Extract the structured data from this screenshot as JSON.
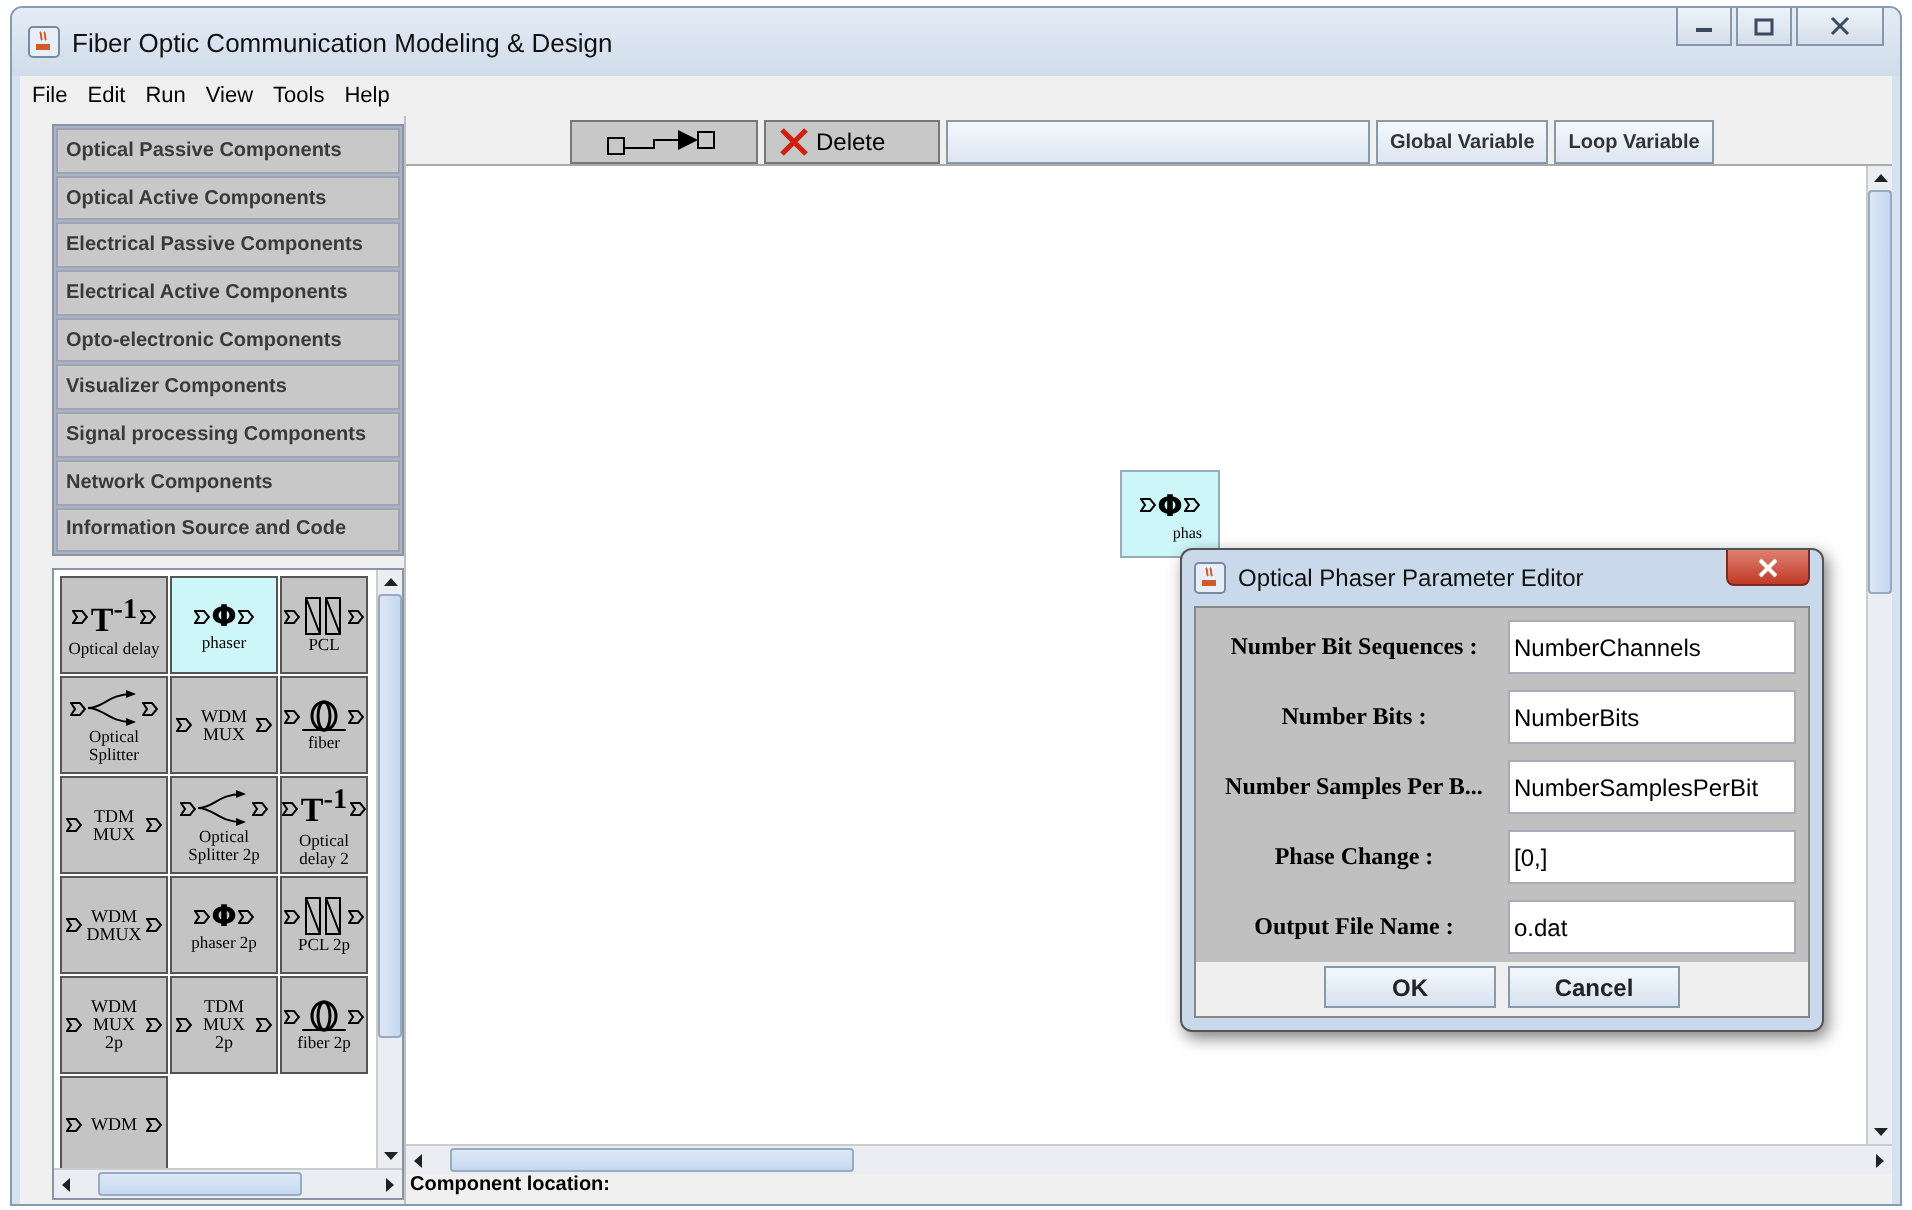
{
  "window": {
    "title": "Fiber Optic Communication Modeling & Design"
  },
  "menu": [
    "File",
    "Edit",
    "Run",
    "View",
    "Tools",
    "Help"
  ],
  "toolbar": {
    "delete": "Delete",
    "buttons": [
      "Global Variable",
      "Loop Variable"
    ]
  },
  "categories": [
    "Optical Passive Components",
    "Optical Active Components",
    "Electrical Passive Components",
    "Electrical Active Components",
    "Opto-electronic Components",
    "Visualizer Components",
    "Signal processing Components",
    "Network Components",
    "Information Source and Code"
  ],
  "palette": [
    {
      "kind": "delay",
      "symbol": "T$^{-1}$",
      "label": "Optical delay",
      "selected": false
    },
    {
      "kind": "phaser",
      "symbol": "Φ",
      "label": "phaser",
      "selected": true
    },
    {
      "kind": "pcl",
      "label": "PCL",
      "selected": false
    },
    {
      "kind": "splitter",
      "label": "Optical Splitter",
      "selected": false
    },
    {
      "kind": "mux",
      "symbol": "WDM MUX",
      "selected": false
    },
    {
      "kind": "fiber",
      "label": "fiber",
      "selected": false
    },
    {
      "kind": "mux",
      "symbol": "TDM MUX",
      "selected": false
    },
    {
      "kind": "splitter",
      "label": "Optical Splitter 2p",
      "selected": false
    },
    {
      "kind": "delay",
      "symbol": "T$^{-1}$",
      "label": "Optical delay 2",
      "selected": false
    },
    {
      "kind": "mux",
      "symbol": "WDM DMUX",
      "selected": false
    },
    {
      "kind": "phaser",
      "symbol": "Φ",
      "label": "phaser 2p",
      "selected": false
    },
    {
      "kind": "pcl",
      "label": "PCL 2p",
      "selected": false
    },
    {
      "kind": "mux",
      "symbol": "WDM MUX 2p",
      "selected": false
    },
    {
      "kind": "mux",
      "symbol": "TDM MUX 2p",
      "selected": false
    },
    {
      "kind": "fiber",
      "label": "fiber 2p",
      "selected": false
    },
    {
      "kind": "mux",
      "symbol": "WDM",
      "selected": false
    }
  ],
  "canvas": {
    "node": {
      "symbol": "Φ",
      "label": "phas",
      "selected": true
    }
  },
  "dialog": {
    "title": "Optical Phaser Parameter Editor",
    "fields": [
      {
        "label": "Number Bit Sequences :",
        "value": "NumberChannels"
      },
      {
        "label": "Number Bits :",
        "value": "NumberBits"
      },
      {
        "label": "Number Samples Per B...",
        "value": "NumberSamplesPerBit"
      },
      {
        "label": "Phase Change :",
        "value": "[0,]"
      },
      {
        "label": "Output File Name :",
        "value": "o.dat"
      }
    ],
    "buttons": [
      "OK",
      "Cancel"
    ]
  },
  "status_bar": "Component location:"
}
